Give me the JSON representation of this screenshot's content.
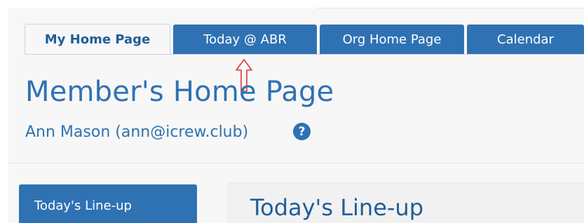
{
  "tabs": [
    {
      "label": "My Home Page",
      "active": true
    },
    {
      "label": "Today @ ABR",
      "active": false
    },
    {
      "label": "Org Home Page",
      "active": false
    },
    {
      "label": "Calendar",
      "active": false
    }
  ],
  "page": {
    "title": "Member's Home Page",
    "user_line": "Ann Mason (ann@icrew.club)",
    "help_glyph": "?"
  },
  "sidebar": {
    "items": [
      {
        "label": "Today's Line-up"
      }
    ]
  },
  "content": {
    "title": "Today's Line-up"
  },
  "colors": {
    "primary": "#2f72b3",
    "primary_dark": "#1f5e99",
    "annotation": "#d9383b",
    "panel_bg": "#f7f7f7"
  },
  "icons": {
    "help": "question-circle-icon",
    "annotation_arrow": "up-arrow-icon"
  }
}
